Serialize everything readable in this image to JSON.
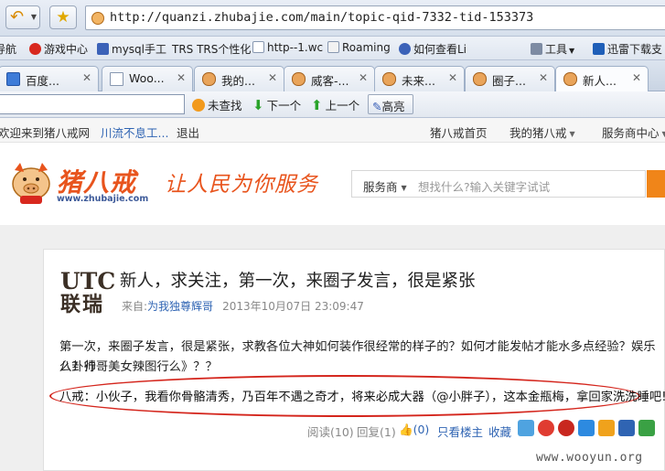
{
  "browser": {
    "url": "http://quanzi.zhubajie.com/main/topic-qid-7332-tid-153373",
    "bookmarks": [
      "导航",
      "游戏中心",
      "mysql手工",
      "TRS TRS个性化",
      "http--1.wc",
      "Roaming",
      "如何查看Li",
      "工具",
      "迅雷下载支"
    ],
    "tabs": [
      "百度...",
      "Woo...",
      "我的...",
      "威客-...",
      "未来...",
      "圈子...",
      "新人..."
    ],
    "toolbar": {
      "find_unfound": "未查找",
      "next": "下一个",
      "prev": "上一个",
      "highlight": "高亮"
    }
  },
  "site_nav": {
    "welcome": "欢迎来到猪八戒网",
    "username": "川流不息工...",
    "logout": "退出",
    "home": "猪八戒首页",
    "my_zbj": "我的猪八戒",
    "service_center": "服务商中心"
  },
  "header": {
    "logo_text": "猪八戒",
    "logo_url": "www.zhubajie.com",
    "slogan": "让人民为你服务",
    "search_category": "服务商",
    "search_placeholder": "想找什么?输入关键字试试"
  },
  "topic": {
    "group_logo_line1": "UTC",
    "group_logo_line2": "联瑞",
    "title": "新人，求关注，第一次，来圈子发言，很是紧张",
    "from_label": "来自:",
    "author": "为我独尊辉哥",
    "date": "2013年10月07日 23:09:47",
    "body_line1": "第一次，来圈子发言，很是紧张，求教各位大神如何装作很经常的样子的？如何才能发帖才能水多点经验？娱乐八卦行",
    "body_line2": "么？帅哥美女辣图行么》？？",
    "reply": "八戒：小伙子，我看你骨骼清秀，乃百年不遇之奇才，将来必成大器（@小胖子），这本金瓶梅，拿回家洗洗睡吧!",
    "reads": "阅读(10)",
    "replies": "回复(1)",
    "likes": "(0)",
    "only_author": "只看楼主",
    "favorite": "收藏"
  },
  "watermark": "www.wooyun.org"
}
